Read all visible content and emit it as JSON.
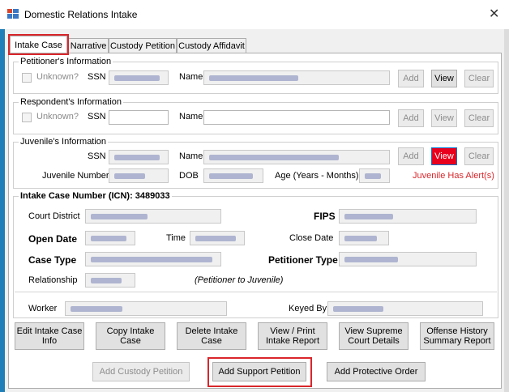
{
  "window": {
    "title": "Domestic Relations Intake",
    "close_glyph": "✕"
  },
  "tabs": [
    {
      "label": "Intake Case",
      "active": true
    },
    {
      "label": "Narrative",
      "active": false
    },
    {
      "label": "Custody Petition",
      "active": false
    },
    {
      "label": "Custody Affidavit",
      "active": false
    }
  ],
  "petitioner": {
    "legend": "Petitioner's Information",
    "unknown_label": "Unknown?",
    "ssn_label": "SSN",
    "name_label": "Name",
    "buttons": {
      "add": "Add",
      "view": "View",
      "clear": "Clear"
    }
  },
  "respondent": {
    "legend": "Respondent's Information",
    "unknown_label": "Unknown?",
    "ssn_label": "SSN",
    "name_label": "Name",
    "buttons": {
      "add": "Add",
      "view": "View",
      "clear": "Clear"
    }
  },
  "juvenile": {
    "legend": "Juvenile's Information",
    "ssn_label": "SSN",
    "name_label": "Name",
    "juvenile_number_label": "Juvenile Number",
    "dob_label": "DOB",
    "age_label": "Age (Years - Months)",
    "alert_text": "Juvenile Has Alert(s)",
    "buttons": {
      "add": "Add",
      "view": "View",
      "clear": "Clear"
    }
  },
  "intake": {
    "legend": "Intake Case Number (ICN): 3489033",
    "court_district_label": "Court District",
    "fips_label": "FIPS",
    "open_date_label": "Open Date",
    "time_label": "Time",
    "close_date_label": "Close Date",
    "case_type_label": "Case Type",
    "petitioner_type_label": "Petitioner Type",
    "relationship_label": "Relationship",
    "relationship_note": "(Petitioner to Juvenile)",
    "worker_label": "Worker",
    "keyed_by_label": "Keyed By"
  },
  "actions": [
    "Edit Intake Case\nInfo",
    "Copy Intake\nCase",
    "Delete Intake\nCase",
    "View / Print\nIntake Report",
    "View Supreme\nCourt Details",
    "Offense History\nSummary Report"
  ],
  "bottom_buttons": {
    "add_custody_petition": "Add Custody Petition",
    "add_support_petition": "Add Support Petition",
    "add_protective_order": "Add Protective Order"
  },
  "colors": {
    "accent_red": "#d9262b",
    "alert_button": "#e8001c",
    "window_edge": "#1f7fb8"
  }
}
